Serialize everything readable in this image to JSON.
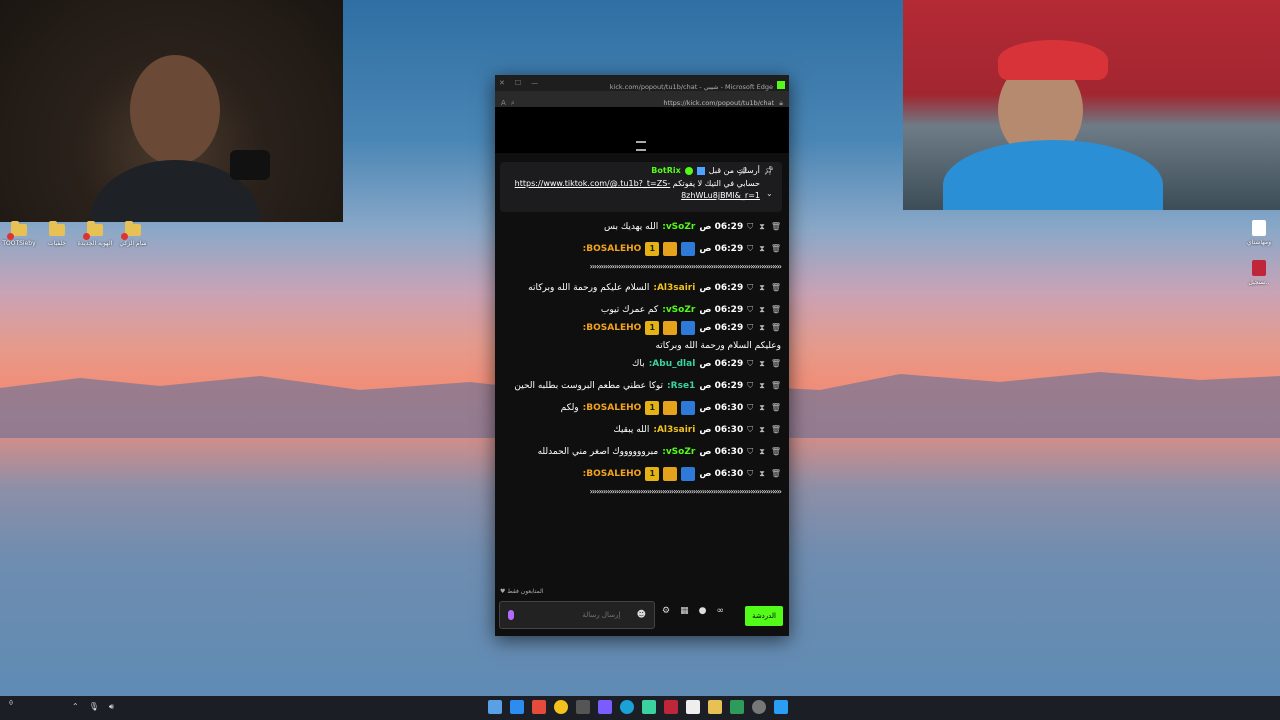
{
  "browser": {
    "title": "kick.com/popout/tu1b/chat - شيبي - Microsoft Edge",
    "url": "https://kick.com/popout/tu1b/chat"
  },
  "pinned": {
    "pinned_by": "أرسلت من قبل",
    "bot_name": "BotRix",
    "message": "حسابي في التيك لا يفوتكم",
    "link": "https://www.tiktok.com/@.tu1b?_t=ZS-8zhWLu8jBMl&_r=1"
  },
  "chat": {
    "messages": [
      {
        "time": "06:29 ص",
        "user": "vSoZr:",
        "text": "الله يهديك بس",
        "user_color": "green",
        "badges": []
      },
      {
        "time": "06:29 ص",
        "user": "BOSALEHO:",
        "text": "",
        "user_color": "orange",
        "badges": [
          "mod",
          "vip",
          "sub"
        ],
        "cont": "‹‹‹‹‹‹‹‹‹‹‹‹‹‹‹‹‹‹‹‹‹‹‹‹‹‹‹‹‹‹‹‹‹‹‹‹‹‹‹‹‹‹‹‹‹‹‹‹‹‹‹‹‹‹‹‹‹‹‹‹‹‹‹‹‹‹‹‹‹‹‹‹‹‹‹‹‹‹‹‹‹‹‹‹‹‹‹"
      },
      {
        "time": "06:29 ص",
        "user": "Al3sairi:",
        "text": "السلام عليكم ورحمة الله وبركاته",
        "user_color": "gold",
        "badges": []
      },
      {
        "time": "06:29 ص",
        "user": "vSoZr:",
        "text": "كم عمرك تيوب",
        "user_color": "green",
        "badges": []
      },
      {
        "time": "06:29 ص",
        "user": "BOSALEHO:",
        "text": "وعليكم السلام ورحمة الله وبركاته",
        "user_color": "orange",
        "badges": [
          "mod",
          "vip",
          "sub"
        ]
      },
      {
        "time": "06:29 ص",
        "user": "Abu_dlal:",
        "text": "باك",
        "user_color": "teal",
        "badges": []
      },
      {
        "time": "06:29 ص",
        "user": "Rse1:",
        "text": "توكا عطني مطعم البروست بطلبه الحين",
        "user_color": "teal",
        "badges": []
      },
      {
        "time": "06:30 ص",
        "user": "BOSALEHO:",
        "text": "ولكم",
        "user_color": "orange",
        "badges": [
          "mod",
          "vip",
          "sub"
        ]
      },
      {
        "time": "06:30 ص",
        "user": "Al3sairi:",
        "text": "الله يبقيك",
        "user_color": "gold",
        "badges": []
      },
      {
        "time": "06:30 ص",
        "user": "vSoZr:",
        "text": "مبرووووووك اصغر مني الحمدلله",
        "user_color": "green",
        "badges": []
      },
      {
        "time": "06:30 ص",
        "user": "BOSALEHO:",
        "text": "",
        "user_color": "orange",
        "badges": [
          "mod",
          "vip",
          "sub"
        ],
        "cont": "‹‹‹‹‹‹‹‹‹‹‹‹‹‹‹‹‹‹‹‹‹‹‹‹‹‹‹‹‹‹‹‹‹‹‹‹‹‹‹‹‹‹‹‹‹‹‹‹‹‹‹‹‹‹‹‹‹‹‹‹‹‹‹‹‹‹‹‹‹‹‹‹‹‹‹‹‹‹‹‹‹‹‹‹‹‹‹"
      }
    ],
    "followers_only": "المتابعون فقط",
    "input_placeholder": "إرسال رسالة",
    "chat_button": "الدردشة"
  },
  "desktop": {
    "left_icons": [
      "TOOTSieby",
      "خلفيات",
      "الهوية الجديدة",
      "شام الزكي"
    ],
    "right_icons": [
      "ومهاشتاي",
      "تسجيل.."
    ]
  },
  "sub_badge": "1",
  "colors": {
    "kick_green": "#53fc18",
    "mod_blue": "#2f7ad9",
    "vip_gold": "#e5a21c"
  }
}
